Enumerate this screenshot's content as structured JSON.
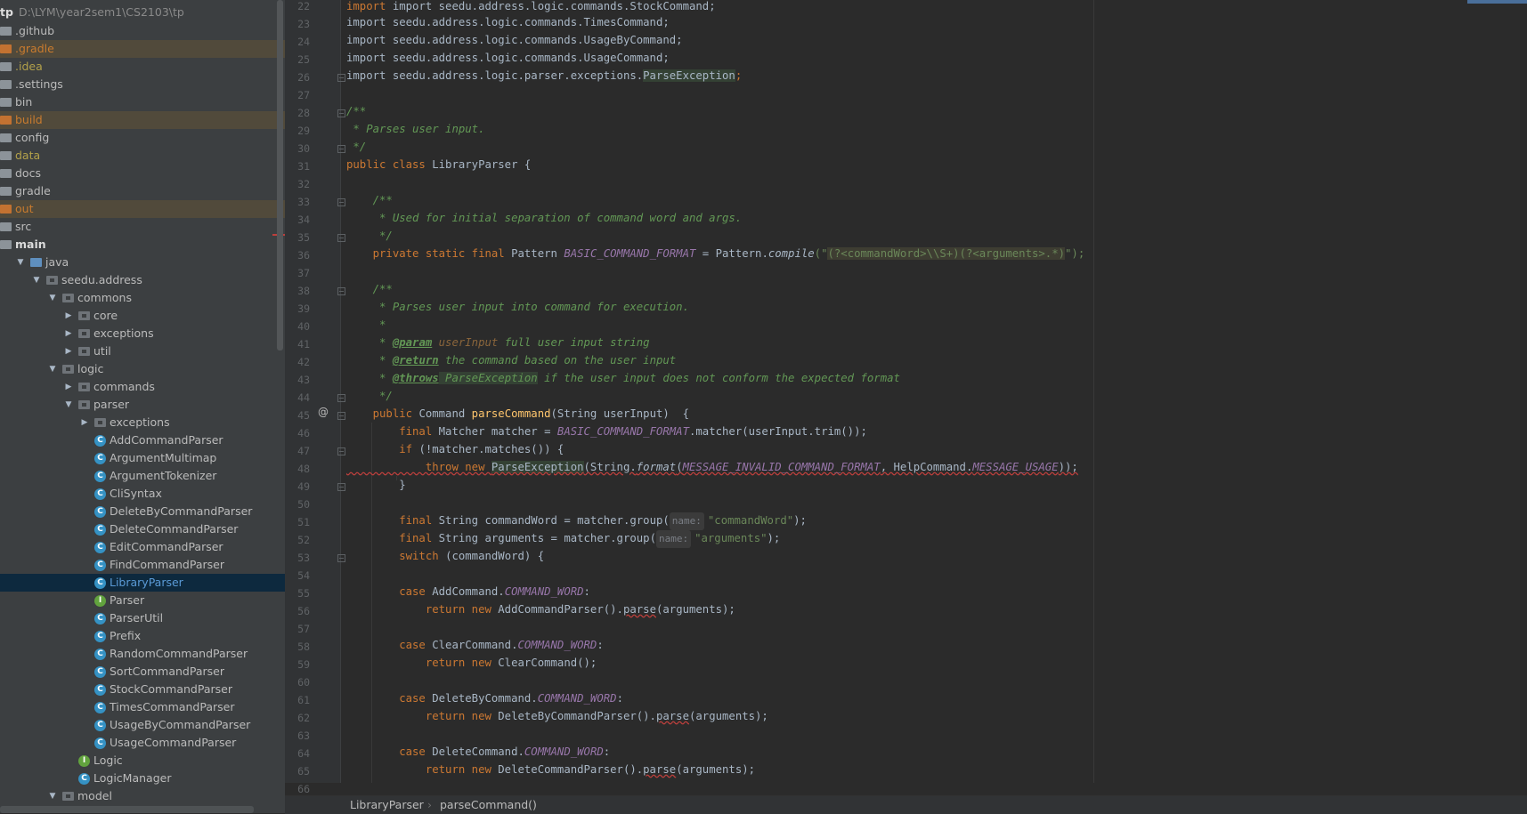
{
  "project": {
    "name": "tp",
    "path": "D:\\LYM\\year2sem1\\CS2103\\tp"
  },
  "tree": [
    {
      "label": ".github",
      "kind": "folder",
      "style": "normal"
    },
    {
      "label": ".gradle",
      "kind": "folder",
      "style": "orange"
    },
    {
      "label": ".idea",
      "kind": "folder",
      "style": "yellow"
    },
    {
      "label": ".settings",
      "kind": "folder",
      "style": "normal"
    },
    {
      "label": "bin",
      "kind": "folder",
      "style": "normal"
    },
    {
      "label": "build",
      "kind": "folder",
      "style": "orange"
    },
    {
      "label": "config",
      "kind": "folder",
      "style": "normal"
    },
    {
      "label": "data",
      "kind": "folder",
      "style": "yellow"
    },
    {
      "label": "docs",
      "kind": "folder",
      "style": "normal"
    },
    {
      "label": "gradle",
      "kind": "folder",
      "style": "normal"
    },
    {
      "label": "out",
      "kind": "folder",
      "style": "orange"
    },
    {
      "label": "src",
      "kind": "folder",
      "style": "normal"
    },
    {
      "label": "main",
      "kind": "folder",
      "style": "bold"
    },
    {
      "label": "java",
      "kind": "src",
      "style": "normal"
    },
    {
      "label": "seedu.address",
      "kind": "pkg",
      "style": "normal"
    },
    {
      "label": "commons",
      "kind": "pkg",
      "style": "normal"
    },
    {
      "label": "core",
      "kind": "pkg",
      "style": "normal"
    },
    {
      "label": "exceptions",
      "kind": "pkg",
      "style": "normal"
    },
    {
      "label": "util",
      "kind": "pkg",
      "style": "normal"
    },
    {
      "label": "logic",
      "kind": "pkg",
      "style": "normal"
    },
    {
      "label": "commands",
      "kind": "pkg",
      "style": "normal"
    },
    {
      "label": "parser",
      "kind": "pkg",
      "style": "normal"
    },
    {
      "label": "exceptions",
      "kind": "pkg",
      "style": "normal"
    },
    {
      "label": "AddCommandParser",
      "kind": "class",
      "style": "normal"
    },
    {
      "label": "ArgumentMultimap",
      "kind": "class",
      "style": "normal"
    },
    {
      "label": "ArgumentTokenizer",
      "kind": "class",
      "style": "normal"
    },
    {
      "label": "CliSyntax",
      "kind": "class",
      "style": "normal"
    },
    {
      "label": "DeleteByCommandParser",
      "kind": "class",
      "style": "normal"
    },
    {
      "label": "DeleteCommandParser",
      "kind": "class",
      "style": "normal"
    },
    {
      "label": "EditCommandParser",
      "kind": "class",
      "style": "normal"
    },
    {
      "label": "FindCommandParser",
      "kind": "class",
      "style": "normal"
    },
    {
      "label": "LibraryParser",
      "kind": "class",
      "style": "selected"
    },
    {
      "label": "Parser",
      "kind": "interface",
      "style": "normal"
    },
    {
      "label": "ParserUtil",
      "kind": "class",
      "style": "normal"
    },
    {
      "label": "Prefix",
      "kind": "class",
      "style": "normal"
    },
    {
      "label": "RandomCommandParser",
      "kind": "class",
      "style": "normal"
    },
    {
      "label": "SortCommandParser",
      "kind": "class",
      "style": "normal"
    },
    {
      "label": "StockCommandParser",
      "kind": "class",
      "style": "normal"
    },
    {
      "label": "TimesCommandParser",
      "kind": "class",
      "style": "normal"
    },
    {
      "label": "UsageByCommandParser",
      "kind": "class",
      "style": "normal"
    },
    {
      "label": "UsageCommandParser",
      "kind": "class",
      "style": "normal"
    },
    {
      "label": "Logic",
      "kind": "interface",
      "style": "normal"
    },
    {
      "label": "LogicManager",
      "kind": "class",
      "style": "normal"
    },
    {
      "label": "model",
      "kind": "pkg",
      "style": "normal"
    }
  ],
  "line_numbers": [
    "22",
    "23",
    "24",
    "25",
    "26",
    "27",
    "28",
    "29",
    "30",
    "31",
    "32",
    "33",
    "34",
    "35",
    "36",
    "37",
    "38",
    "39",
    "40",
    "41",
    "42",
    "43",
    "44",
    "45",
    "46",
    "47",
    "48",
    "49",
    "50",
    "51",
    "52",
    "53",
    "54",
    "55",
    "56",
    "57",
    "58",
    "59",
    "60",
    "61",
    "62",
    "63",
    "64",
    "65",
    "66"
  ],
  "code": {
    "l22": "import seedu.address.logic.commands.StockCommand;",
    "l23": "import seedu.address.logic.commands.TimesCommand;",
    "l24": "import seedu.address.logic.commands.UsageByCommand;",
    "l25": "import seedu.address.logic.commands.UsageCommand;",
    "l26a": "import seedu.address.logic.parser.exceptions.",
    "l26b": "ParseException",
    "l28": "/**",
    "l29": " * Parses user input.",
    "l30": " */",
    "l31a": "public class ",
    "l31b": "LibraryParser {",
    "l33": "    /**",
    "l34": "     * Used for initial separation of command word and args.",
    "l35": "     */",
    "l36a": "    private static final ",
    "l36b": "Pattern ",
    "l36c": "BASIC_COMMAND_FORMAT",
    "l36d": " = Pattern.",
    "l36e": "compile",
    "l36f": "(\"",
    "l36g": "(?<commandWord>\\\\S+)(?<arguments>.*)",
    "l36h": "\");",
    "l38": "    /**",
    "l39": "     * Parses user input into command for execution.",
    "l40": "     *",
    "l41a": "     * ",
    "l41b": "@param",
    "l41c": " userInput",
    "l41d": " full user input string",
    "l42a": "     * ",
    "l42b": "@return",
    "l42c": " the command based on the user input",
    "l43a": "     * ",
    "l43b": "@throws",
    "l43c": " ParseException",
    "l43d": " if the user input does not conform the expected format",
    "l44": "     */",
    "l45a": "    public ",
    "l45b": "Command ",
    "l45c": "parseCommand",
    "l45d": "(String userInput)  {",
    "l46a": "        final ",
    "l46b": "Matcher matcher = ",
    "l46c": "BASIC_COMMAND_FORMAT",
    "l46d": ".matcher(userInput.trim());",
    "l47a": "        if ",
    "l47b": "(!matcher.matches()) {",
    "l48a": "            throw new ",
    "l48b": "ParseException",
    "l48c": "(String.",
    "l48d": "format",
    "l48e": "(",
    "l48f": "MESSAGE_INVALID_COMMAND_FORMAT",
    "l48g": ", HelpCommand.",
    "l48h": "MESSAGE_USAGE",
    "l48i": "));",
    "l49": "        }",
    "l51a": "        final ",
    "l51b": "String commandWord = matcher.group(",
    "l51hint": "name:",
    "l51c": "\"commandWord\"",
    "l51d": ");",
    "l52a": "        final ",
    "l52b": "String arguments = matcher.group(",
    "l52hint": "name:",
    "l52c": "\"arguments\"",
    "l52d": ");",
    "l53a": "        switch ",
    "l53b": "(commandWord) {",
    "l55a": "        case ",
    "l55b": "AddCommand.",
    "l55c": "COMMAND_WORD",
    "l55d": ":",
    "l56a": "            return new ",
    "l56b": "AddCommandParser().",
    "l56c": "parse",
    "l56d": "(arguments);",
    "l58a": "        case ",
    "l58b": "ClearCommand.",
    "l58c": "COMMAND_WORD",
    "l58d": ":",
    "l59a": "            return new ",
    "l59b": "ClearCommand();",
    "l61a": "        case ",
    "l61b": "DeleteByCommand.",
    "l61c": "COMMAND_WORD",
    "l61d": ":",
    "l62a": "            return new ",
    "l62b": "DeleteByCommandParser().",
    "l62c": "parse",
    "l62d": "(arguments);",
    "l64a": "        case ",
    "l64b": "DeleteCommand.",
    "l64c": "COMMAND_WORD",
    "l64d": ":",
    "l65a": "            return new ",
    "l65b": "DeleteCommandParser().",
    "l65c": "parse",
    "l65d": "(arguments);"
  },
  "gutter_marker": "@",
  "breadcrumb": [
    "LibraryParser",
    "parseCommand()"
  ],
  "breadcrumb_separator": "›",
  "colors": {
    "keyword": "#cc7832",
    "comment": "#629755",
    "string": "#6a8759",
    "constant": "#9876aa",
    "method": "#ffc66d",
    "selection": "#0d293e"
  }
}
